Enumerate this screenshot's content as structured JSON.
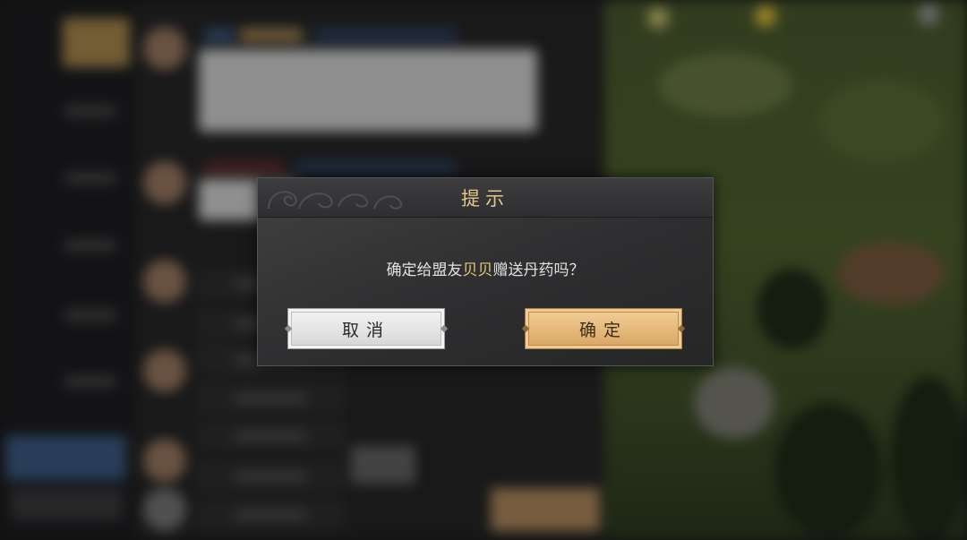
{
  "dialog": {
    "title": "提示",
    "message": {
      "prefix": "确定给盟友",
      "player_name": "贝贝",
      "suffix": "赠送丹药吗？"
    },
    "cancel_label": "取消",
    "confirm_label": "确定"
  },
  "colors": {
    "title": "#e6c58a",
    "highlight_name": "#e8c77a",
    "confirm_button": "#e5b87a",
    "cancel_button": "#e2e2e2"
  },
  "icons": [
    "cloud-ornament-icon",
    "diamond-corner-icon"
  ]
}
